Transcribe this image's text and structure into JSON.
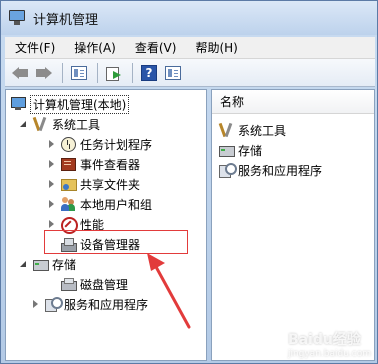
{
  "window": {
    "title": "计算机管理"
  },
  "menu": [
    {
      "label": "文件(F)"
    },
    {
      "label": "操作(A)"
    },
    {
      "label": "查看(V)"
    },
    {
      "label": "帮助(H)"
    }
  ],
  "toolbar": {
    "buttons": [
      "back-icon",
      "forward-icon",
      "show-hide-tree-icon",
      "export-list-icon",
      "help-icon",
      "action-pane-icon"
    ],
    "help_glyph": "?"
  },
  "tree": {
    "root": "计算机管理(本地)",
    "system_tools": "系统工具",
    "items": {
      "task_scheduler": "任务计划程序",
      "event_viewer": "事件查看器",
      "shared_folders": "共享文件夹",
      "local_users": "本地用户和组",
      "performance": "性能",
      "device_manager": "设备管理器"
    },
    "storage": "存储",
    "disk_management": "磁盘管理",
    "services_apps": "服务和应用程序"
  },
  "list": {
    "column_header": "名称",
    "rows": [
      "系统工具",
      "存储",
      "服务和应用程序"
    ]
  },
  "annotation": {
    "color": "#e23b3b"
  },
  "watermark": {
    "text": "Baidu经验",
    "sub": "jingyan.baidu.com"
  }
}
